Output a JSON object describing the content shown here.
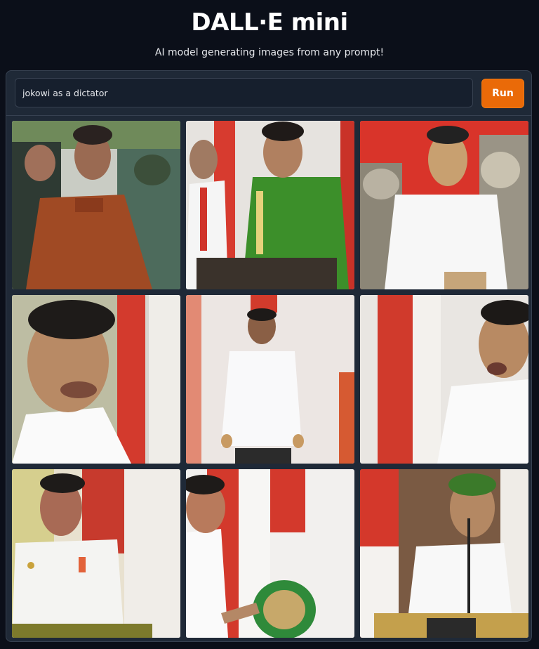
{
  "header": {
    "title": "DALL·E mini",
    "subtitle": "AI model generating images from any prompt!"
  },
  "prompt": {
    "value": "jokowi as a dictator"
  },
  "run_button": {
    "label": "Run"
  },
  "colors": {
    "background": "#0b0f19",
    "panel": "#1f2937",
    "run_button": "#ea6a08"
  },
  "gallery": {
    "image_count": 9
  }
}
